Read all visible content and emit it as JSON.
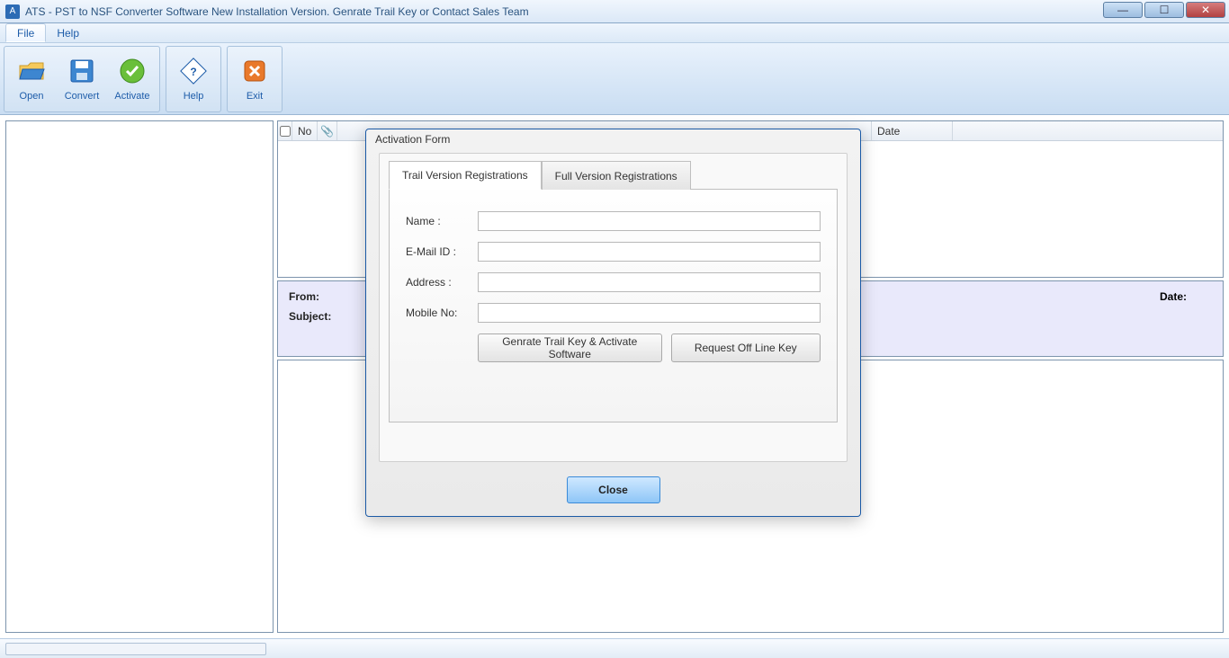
{
  "window": {
    "title": "ATS - PST to NSF Converter Software New Installation Version. Genrate Trail Key or Contact Sales Team"
  },
  "menu": {
    "file": "File",
    "help": "Help"
  },
  "toolbar": {
    "open": "Open",
    "convert": "Convert",
    "activate": "Activate",
    "help": "Help",
    "exit": "Exit"
  },
  "grid": {
    "columns": {
      "no": "No",
      "date": "Date"
    }
  },
  "detail": {
    "from": "From:",
    "subject": "Subject:",
    "date": "Date:"
  },
  "modal": {
    "title": "Activation Form",
    "tabs": {
      "trail": "Trail Version Registrations",
      "full": "Full Version Registrations"
    },
    "fields": {
      "name": "Name :",
      "email": "E-Mail ID :",
      "address": "Address :",
      "mobile": "Mobile No:"
    },
    "buttons": {
      "generate": "Genrate Trail Key & Activate Software",
      "offline": "Request Off Line Key",
      "close": "Close"
    }
  }
}
